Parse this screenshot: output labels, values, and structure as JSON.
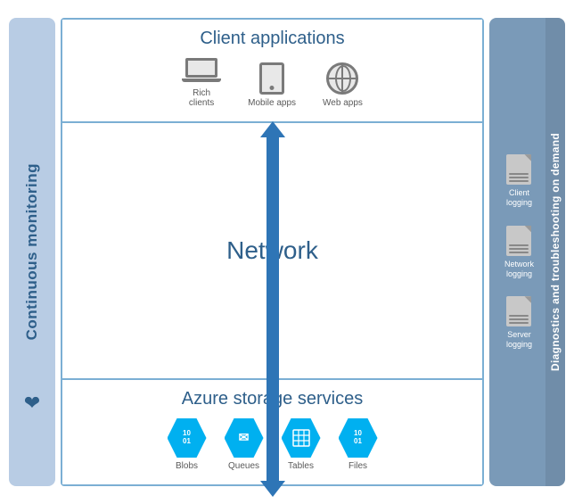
{
  "left_sidebar": {
    "label": "Continuous monitoring",
    "heart_icon": "♥"
  },
  "client_apps": {
    "title": "Client applications",
    "icons": [
      {
        "name": "Rich clients",
        "type": "laptop"
      },
      {
        "name": "Mobile apps",
        "type": "tablet"
      },
      {
        "name": "Web apps",
        "type": "globe"
      }
    ]
  },
  "network": {
    "title": "Network"
  },
  "storage": {
    "title": "Azure storage services",
    "icons": [
      {
        "name": "Blobs",
        "type": "binary",
        "symbol": "10\n01"
      },
      {
        "name": "Queues",
        "type": "envelope",
        "symbol": "✉"
      },
      {
        "name": "Tables",
        "type": "grid",
        "symbol": "▦"
      },
      {
        "name": "Files",
        "type": "binary2",
        "symbol": "10\n01"
      }
    ]
  },
  "right_sidebar": {
    "label": "Diagnostics and troubleshooting on demand",
    "logging_items": [
      {
        "name": "Client\nlogging",
        "type": "doc"
      },
      {
        "name": "Network\nlogging",
        "type": "doc"
      },
      {
        "name": "Server\nlogging",
        "type": "doc"
      }
    ]
  }
}
